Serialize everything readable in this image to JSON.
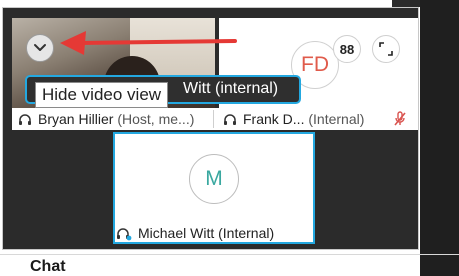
{
  "tooltip": {
    "text": "Hide video view"
  },
  "banner": {
    "name": "Witt (internal)"
  },
  "top_tile": {
    "avatar_initials": "FD",
    "grid_icon_text": "88"
  },
  "strip": {
    "left_name": "Bryan Hillier",
    "left_role": "(Host, me...)",
    "right_name": "Frank D...",
    "right_role": "(Internal)"
  },
  "main_tile": {
    "avatar_initial": "M",
    "name": "Michael Witt",
    "role": "(Internal)"
  },
  "chat": {
    "label": "Chat"
  },
  "colors": {
    "accent": "#23a8e0",
    "arrow": "#e53935",
    "mute": "#d9534f",
    "fd": "#e05b4b",
    "m": "#3aa8a0"
  },
  "icons": [
    "chevron-down-icon",
    "grid-icon",
    "expand-icon",
    "headset-icon",
    "mic-off-icon"
  ]
}
